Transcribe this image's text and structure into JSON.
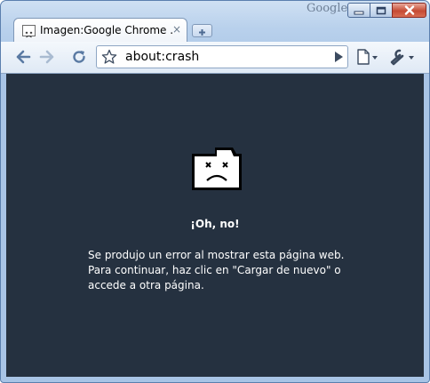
{
  "window": {
    "brand_text": "Google",
    "frame_color": "#a8c4e6",
    "controls": [
      "minimize-icon",
      "maximize-icon",
      "close-icon"
    ]
  },
  "tabs": [
    {
      "title": "Imagen:Google Chrome ...",
      "active": true,
      "favicon": "sad-tab-favicon-icon",
      "close": "×"
    }
  ],
  "toolbar": {
    "back": "back-arrow-icon",
    "forward": "forward-arrow-icon",
    "reload": "reload-icon",
    "address": "about:crash",
    "star": "star-icon",
    "go": "go-arrow-icon",
    "page_menu": "page-menu-icon",
    "wrench_menu": "wrench-icon"
  },
  "crash_page": {
    "background": "#253140",
    "icon": "sad-folder-icon",
    "title": "¡Oh, no!",
    "lines": [
      "Se produjo un error al mostrar esta página web.",
      "Para continuar, haz clic en \"Cargar de nuevo\" o",
      "accede a otra página."
    ]
  }
}
